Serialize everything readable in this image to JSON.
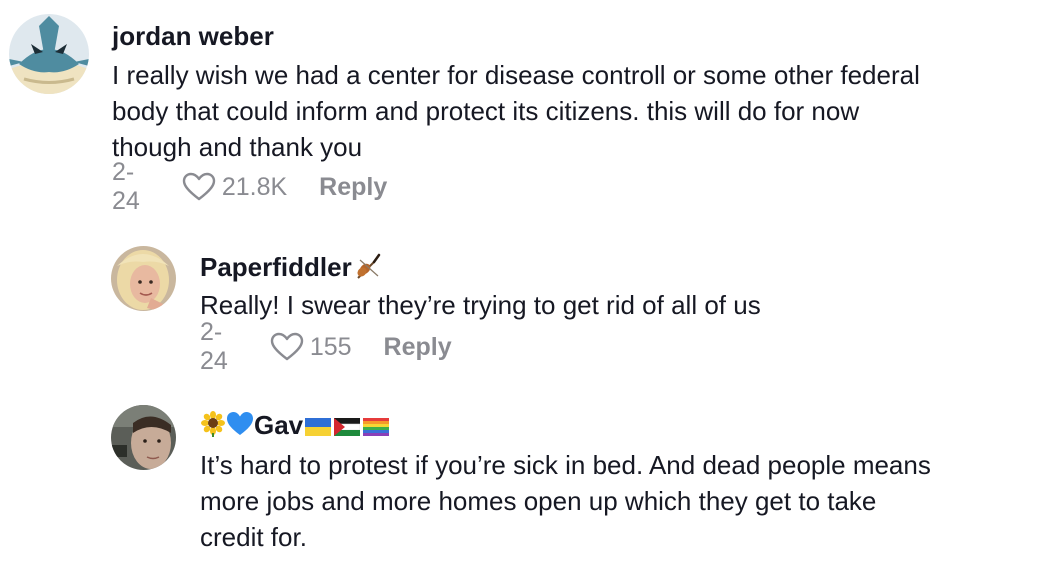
{
  "comments": [
    {
      "username": "jordan weber",
      "lines": [
        "I really wish we had a center for disease controll or some other federal",
        "body that could inform and protect its citizens. this will do for now",
        "though and thank you"
      ],
      "date": "2-24",
      "likes": "21.8K",
      "reply_label": "Reply"
    },
    {
      "username": "Paperfiddler",
      "username_emoji": "violin",
      "lines": [
        "Really! I swear they’re trying to get rid of all of us"
      ],
      "date": "2-24",
      "likes": "155",
      "reply_label": "Reply"
    },
    {
      "username": "Gav",
      "username_prefix_emoji": [
        "sunflower",
        "blue-heart"
      ],
      "username_suffix_emoji": [
        "ukraine-flag",
        "palestine-flag",
        "rainbow-flag"
      ],
      "lines": [
        "It’s hard to protest if you’re sick in bed. And dead people means",
        "more jobs and more homes open up which they get to take",
        "credit for."
      ]
    }
  ],
  "colors": {
    "text": "#161823",
    "meta": "#8a8b91"
  }
}
